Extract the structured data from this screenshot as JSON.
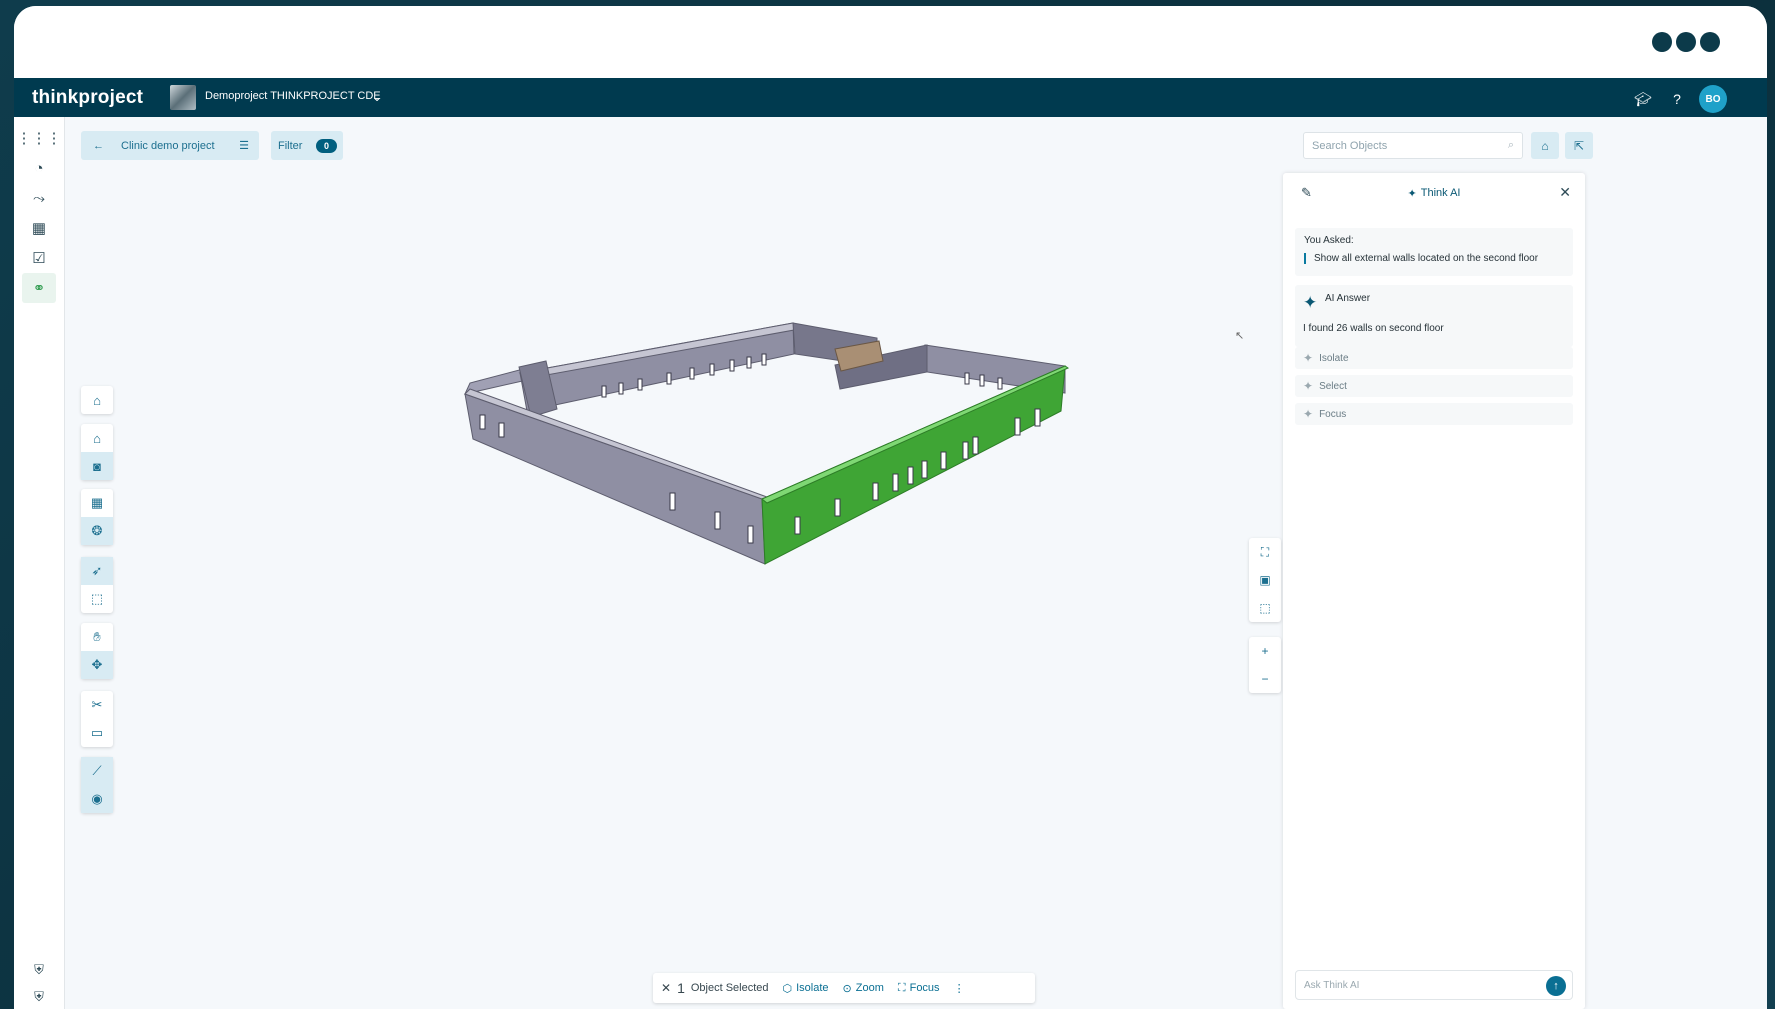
{
  "window": {
    "controls": [
      "dot",
      "dot",
      "dot"
    ]
  },
  "topbar": {
    "brand": "thinkproject",
    "project_name": "Demoproject THINKPROJECT CDE",
    "avatar_initials": "BO"
  },
  "toolbar": {
    "breadcrumb_label": "Clinic demo project",
    "filter_label": "Filter",
    "filter_count": "0",
    "search_placeholder": "Search Objects"
  },
  "ai_panel": {
    "title": "Think AI",
    "you_asked_label": "You Asked:",
    "question": "Show all external walls located on the second floor",
    "answer_label": "AI Answer",
    "answer": "I found 26 walls on second floor",
    "actions": [
      "Isolate",
      "Select",
      "Focus"
    ],
    "input_placeholder": "Ask Think AI"
  },
  "selection_bar": {
    "count": "1",
    "label": "Object Selected",
    "isolate": "Isolate",
    "zoom": "Zoom",
    "focus": "Focus"
  },
  "colors": {
    "brand_dark": "#003a4f",
    "accent": "#1c6f8f",
    "selected_green": "#3fa535",
    "wall_gray": "#8f8fa3"
  }
}
